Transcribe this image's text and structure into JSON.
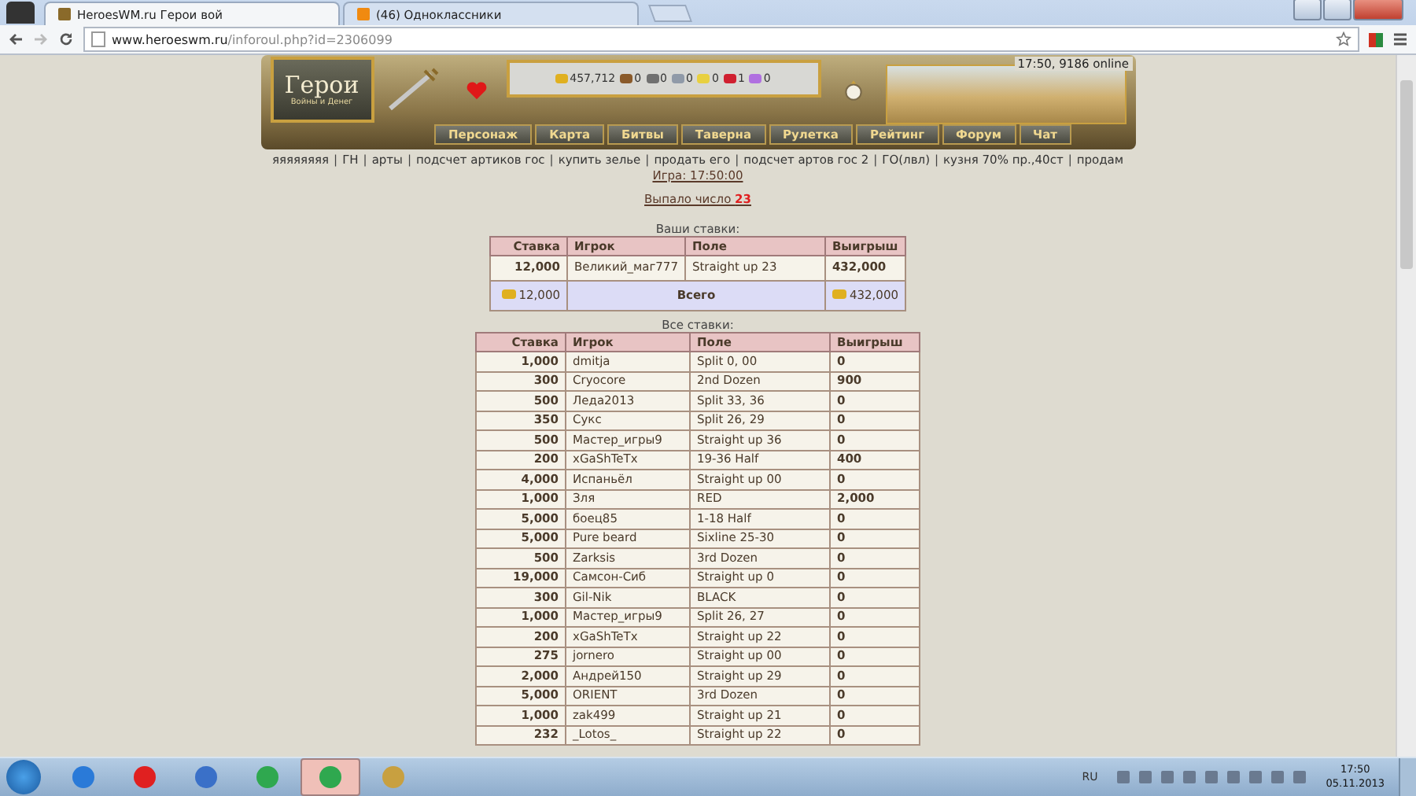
{
  "browser": {
    "tabs": [
      {
        "title": "HeroesWM.ru Герои вой",
        "selected": true
      },
      {
        "title": "(46) Одноклассники",
        "selected": false
      }
    ],
    "url_host": "www.heroeswm.ru",
    "url_path": "/inforoul.php?id=2306099"
  },
  "header": {
    "logo_title": "Герои",
    "logo_subtitle": "Войны и Денег",
    "status": "17:50, 9186 online",
    "resources": [
      {
        "kind": "gold",
        "amount": "457,712"
      },
      {
        "kind": "wood",
        "amount": "0"
      },
      {
        "kind": "ore",
        "amount": "0"
      },
      {
        "kind": "mercury",
        "amount": "0"
      },
      {
        "kind": "sulfur",
        "amount": "0"
      },
      {
        "kind": "crystal",
        "amount": "1"
      },
      {
        "kind": "gems",
        "amount": "0"
      }
    ],
    "nav": [
      "Персонаж",
      "Карта",
      "Битвы",
      "Таверна",
      "Рулетка",
      "Рейтинг",
      "Форум",
      "Чат"
    ]
  },
  "link_separator": "|",
  "links": [
    "яяяяяяяя",
    "ГН",
    "арты",
    "подсчет артиков гос",
    "купить зелье",
    "продать его",
    "подсчет артов гос 2",
    "ГО(лвл)",
    "кузня 70% пр.,40ст",
    "продам"
  ],
  "game_time": "Игра: 17:50:00",
  "result": {
    "label": "Выпало число",
    "number": "23"
  },
  "your_bets": {
    "title": "Ваши ставки:",
    "columns": [
      "Ставка",
      "Игрок",
      "Поле",
      "Выигрыш"
    ],
    "rows": [
      {
        "bet": "12,000",
        "player": "Великий_маг777",
        "field": "Straight up 23",
        "win": "432,000"
      }
    ],
    "total": {
      "bet": "12,000",
      "label": "Всего",
      "win": "432,000"
    }
  },
  "all_bets": {
    "title": "Все ставки:",
    "columns": [
      "Ставка",
      "Игрок",
      "Поле",
      "Выигрыш"
    ],
    "rows": [
      {
        "bet": "1,000",
        "player": "dmitja",
        "field": "Split 0, 00",
        "win": "0"
      },
      {
        "bet": "300",
        "player": "Cryocore",
        "field": "2nd Dozen",
        "win": "900"
      },
      {
        "bet": "500",
        "player": "Леда2013",
        "field": "Split 33, 36",
        "win": "0"
      },
      {
        "bet": "350",
        "player": "Сукс",
        "field": "Split 26, 29",
        "win": "0"
      },
      {
        "bet": "500",
        "player": "Мастер_игры9",
        "field": "Straight up 36",
        "win": "0"
      },
      {
        "bet": "200",
        "player": "xGaShTeTx",
        "field": "19-36 Half",
        "win": "400"
      },
      {
        "bet": "4,000",
        "player": "Испаньёл",
        "field": "Straight up 00",
        "win": "0"
      },
      {
        "bet": "1,000",
        "player": "Зля",
        "field": "RED",
        "win": "2,000"
      },
      {
        "bet": "5,000",
        "player": "боец85",
        "field": "1-18 Half",
        "win": "0"
      },
      {
        "bet": "5,000",
        "player": "Pure beard",
        "field": "Sixline 25-30",
        "win": "0"
      },
      {
        "bet": "500",
        "player": "Zarksis",
        "field": "3rd Dozen",
        "win": "0"
      },
      {
        "bet": "19,000",
        "player": "Самсон-Сиб",
        "field": "Straight up 0",
        "win": "0"
      },
      {
        "bet": "300",
        "player": "Gil-Nik",
        "field": "BLACK",
        "win": "0"
      },
      {
        "bet": "1,000",
        "player": "Мастер_игры9",
        "field": "Split 26, 27",
        "win": "0"
      },
      {
        "bet": "200",
        "player": "xGaShTeTx",
        "field": "Straight up 22",
        "win": "0"
      },
      {
        "bet": "275",
        "player": "jornero",
        "field": "Straight up 00",
        "win": "0"
      },
      {
        "bet": "2,000",
        "player": "Андрей150",
        "field": "Straight up 29",
        "win": "0"
      },
      {
        "bet": "5,000",
        "player": "ORIENT",
        "field": "3rd Dozen",
        "win": "0"
      },
      {
        "bet": "1,000",
        "player": "zak499",
        "field": "Straight up 21",
        "win": "0"
      },
      {
        "bet": "232",
        "player": "_Lotos_",
        "field": "Straight up 22",
        "win": "0"
      }
    ]
  },
  "taskbar": {
    "apps": [
      {
        "kind": "ie",
        "selected": false
      },
      {
        "kind": "yandex",
        "selected": false
      },
      {
        "kind": "media",
        "selected": false
      },
      {
        "kind": "chrome",
        "selected": false
      },
      {
        "kind": "chrome",
        "selected": true
      },
      {
        "kind": "paint",
        "selected": false
      }
    ],
    "language": "RU",
    "time": "17:50",
    "date": "05.11.2013"
  }
}
